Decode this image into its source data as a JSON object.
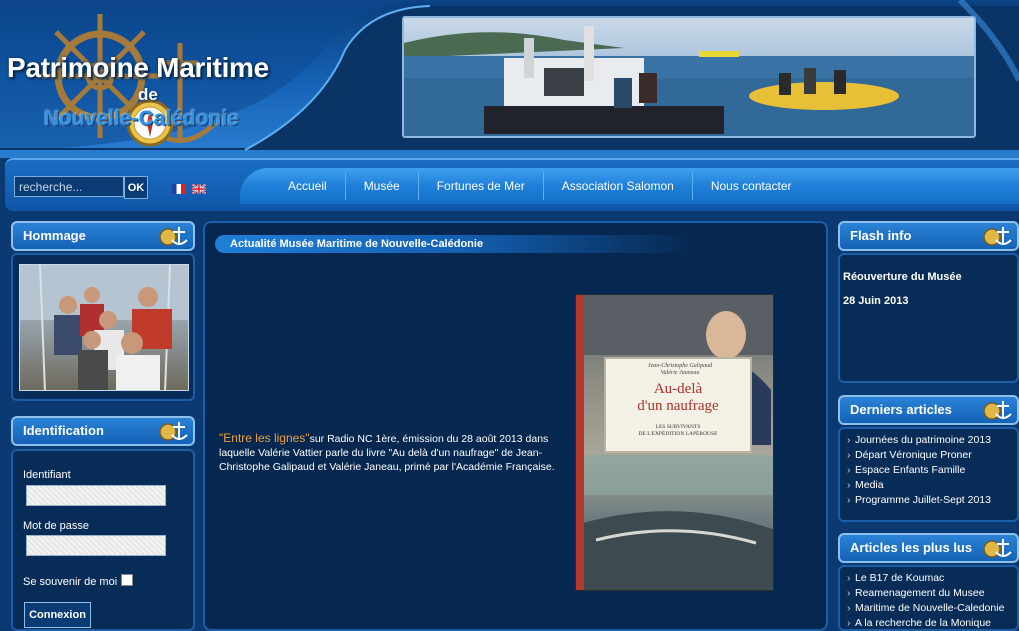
{
  "header": {
    "title": "Patrimoine Maritime",
    "de": "de",
    "subtitle": "Nouvelle-Calédonie"
  },
  "search": {
    "placeholder": "recherche...",
    "button_label": "OK"
  },
  "languages": [
    "fr-flag-icon",
    "uk-flag-icon"
  ],
  "nav": {
    "items": [
      {
        "label": "Accueil"
      },
      {
        "label": "Musée"
      },
      {
        "label": "Fortunes de Mer"
      },
      {
        "label": "Association Salomon"
      },
      {
        "label": "Nous contacter"
      }
    ]
  },
  "left": {
    "hommage_title": "Hommage",
    "identification_title": "Identification",
    "username_label": "Identifiant",
    "password_label": "Mot de passe",
    "remember_label": "Se souvenir de moi",
    "login_button": "Connexion"
  },
  "center": {
    "title": "Actualité Musée Maritime de Nouvelle-Calédonie",
    "article_link": "\"Entre les lignes\"",
    "article_text": "sur Radio NC 1ère, émission du 28 août 2013 dans laquelle Valérie Vattier parle du livre \"Au delà d'un naufrage\" de Jean-Christophe Galipaud et Valérie Janeau, primé par l'Académie Française.",
    "book": {
      "authors_line1": "Jean-Christophe Galipaud",
      "authors_line2": "Valérie Jauneau",
      "title_line1": "Au-delà",
      "title_line2": "d'un naufrage",
      "subtitle_line1": "LES SURVIVANTS",
      "subtitle_line2": "DE L'EXPÉDITION LAPÉROUSE"
    }
  },
  "right": {
    "flash_title": "Flash info",
    "flash_line1": "Réouverture du Musée",
    "flash_line2": "28 Juin 2013",
    "recent_title": "Derniers articles",
    "recent_items": [
      "Journées du patrimoine 2013",
      "Départ Véronique Proner",
      "Espace Enfants Famille",
      "Media",
      "Programme Juillet-Sept 2013"
    ],
    "popular_title": "Articles les plus lus",
    "popular_items": [
      "Le B17 de Koumac",
      "Reamenagement du Musee",
      "Maritime de Nouvelle-Caledonie",
      "A la recherche de la Monique"
    ]
  },
  "colors": {
    "background": "#0b3a72",
    "accent": "#2a82d6",
    "link": "#f0a23a"
  }
}
